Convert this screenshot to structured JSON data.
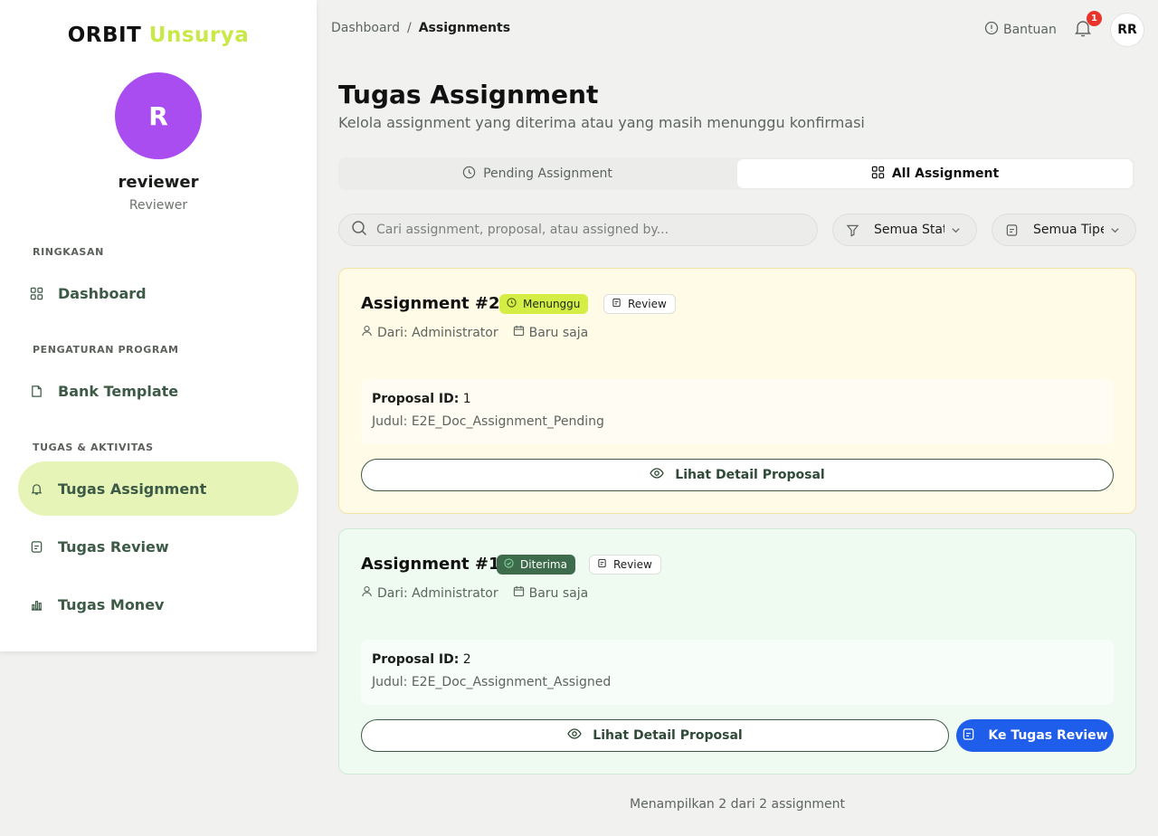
{
  "colors": {
    "brand_accent": "#c9e84a",
    "avatar": "#a94df0",
    "active_nav": "#e6f4b8",
    "pending_badge": "#d5ee46",
    "accepted_badge": "#3d6b4c",
    "primary_button": "#1e5eea",
    "notification": "#e9342b"
  },
  "brand": {
    "part1": "ORBIT",
    "part2": "Unsurya"
  },
  "user": {
    "initial": "R",
    "name": "reviewer",
    "role": "Reviewer"
  },
  "sidebar": {
    "sections": [
      {
        "title": "RINGKASAN",
        "items": [
          {
            "label": "Dashboard",
            "icon": "grid-icon"
          }
        ]
      },
      {
        "title": "PENGATURAN PROGRAM",
        "items": [
          {
            "label": "Bank Template",
            "icon": "file-icon"
          }
        ]
      },
      {
        "title": "TUGAS & AKTIVITAS",
        "items": [
          {
            "label": "Tugas Assignment",
            "icon": "bell-icon",
            "active": true
          },
          {
            "label": "Tugas Review",
            "icon": "document-icon"
          },
          {
            "label": "Tugas Monev",
            "icon": "bar-chart-icon"
          }
        ]
      }
    ]
  },
  "header": {
    "breadcrumb": {
      "root": "Dashboard",
      "sep": "/",
      "current": "Assignments"
    },
    "help_label": "Bantuan",
    "notification_count": "1",
    "avatar_initials": "RR"
  },
  "page": {
    "title": "Tugas Assignment",
    "subtitle": "Kelola assignment yang diterima atau yang masih menunggu konfirmasi"
  },
  "tabs": {
    "pending": "Pending Assignment",
    "all": "All Assignment",
    "active": "all"
  },
  "filters": {
    "search_placeholder": "Cari assignment, proposal, atau assigned by...",
    "status_value": "Semua Status",
    "type_value": "Semua Tipe"
  },
  "assignments": [
    {
      "title": "Assignment #2",
      "status": "Menunggu",
      "type": "Review",
      "from": "Dari: Administrator",
      "time": "Baru saja",
      "proposal_id_label": "Proposal ID:",
      "proposal_id": "1",
      "judul": "Judul: E2E_Doc_Assignment_Pending",
      "detail_button": "Lihat Detail Proposal"
    },
    {
      "title": "Assignment #1",
      "status": "Diterima",
      "type": "Review",
      "from": "Dari: Administrator",
      "time": "Baru saja",
      "proposal_id_label": "Proposal ID:",
      "proposal_id": "2",
      "judul": "Judul: E2E_Doc_Assignment_Assigned",
      "detail_button": "Lihat Detail Proposal",
      "review_button": "Ke Tugas Review"
    }
  ],
  "footer": {
    "summary": "Menampilkan 2 dari 2 assignment"
  }
}
